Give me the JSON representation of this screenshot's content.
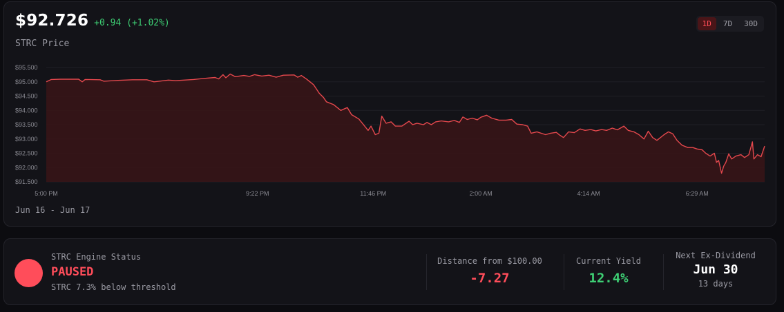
{
  "header": {
    "price": "$92.726",
    "change": "+0.94 (+1.02%)",
    "symbol_label": "STRC Price"
  },
  "timeframes": [
    {
      "label": "1D",
      "active": true
    },
    {
      "label": "7D",
      "active": false
    },
    {
      "label": "30D",
      "active": false
    }
  ],
  "date_range": "Jun 16 - Jun 17",
  "colors": {
    "line": "#e5484d",
    "fill": "#3a1518",
    "positive": "#3ecf74",
    "negative": "#ff4d5a"
  },
  "chart_data": {
    "type": "area",
    "y_ticks": [
      "$95.500",
      "$95.000",
      "$94.500",
      "$94.000",
      "$93.500",
      "$93.000",
      "$92.500",
      "$92.000",
      "$91.500"
    ],
    "ylim": [
      91.5,
      95.5
    ],
    "x_ticks": [
      "5:00 PM",
      "9:22 PM",
      "11:46 PM",
      "2:00 AM",
      "4:14 AM",
      "6:29 AM"
    ],
    "xlim": [
      0,
      100
    ],
    "x_tick_positions": [
      0,
      29.4,
      45.5,
      60.5,
      75.5,
      90.6
    ],
    "grid": true,
    "points": [
      [
        0,
        95.0
      ],
      [
        0.7,
        95.08
      ],
      [
        2,
        95.09
      ],
      [
        4.5,
        95.09
      ],
      [
        5,
        95.0
      ],
      [
        5.4,
        95.08
      ],
      [
        7.5,
        95.07
      ],
      [
        8,
        95.02
      ],
      [
        10,
        95.05
      ],
      [
        12,
        95.07
      ],
      [
        14,
        95.07
      ],
      [
        15,
        95.0
      ],
      [
        17,
        95.06
      ],
      [
        18,
        95.04
      ],
      [
        20.5,
        95.08
      ],
      [
        22,
        95.12
      ],
      [
        23.5,
        95.15
      ],
      [
        24,
        95.1
      ],
      [
        24.6,
        95.25
      ],
      [
        25,
        95.14
      ],
      [
        25.6,
        95.27
      ],
      [
        26.3,
        95.18
      ],
      [
        27.5,
        95.22
      ],
      [
        28.3,
        95.19
      ],
      [
        29,
        95.25
      ],
      [
        30,
        95.2
      ],
      [
        31,
        95.23
      ],
      [
        32,
        95.16
      ],
      [
        33,
        95.23
      ],
      [
        34.5,
        95.24
      ],
      [
        35,
        95.16
      ],
      [
        35.5,
        95.22
      ],
      [
        36.2,
        95.1
      ],
      [
        37.2,
        94.9
      ],
      [
        38,
        94.6
      ],
      [
        38.6,
        94.45
      ],
      [
        39,
        94.3
      ],
      [
        40,
        94.2
      ],
      [
        41,
        94.0
      ],
      [
        41.9,
        94.1
      ],
      [
        42.5,
        93.85
      ],
      [
        43.5,
        93.7
      ],
      [
        44,
        93.55
      ],
      [
        44.8,
        93.3
      ],
      [
        45.2,
        93.45
      ],
      [
        45.8,
        93.15
      ],
      [
        46.3,
        93.2
      ],
      [
        46.7,
        93.8
      ],
      [
        47.3,
        93.55
      ],
      [
        48,
        93.6
      ],
      [
        48.6,
        93.45
      ],
      [
        49.5,
        93.45
      ],
      [
        50.5,
        93.62
      ],
      [
        51,
        93.5
      ],
      [
        51.6,
        93.55
      ],
      [
        52.5,
        93.5
      ],
      [
        53,
        93.58
      ],
      [
        53.6,
        93.5
      ],
      [
        54.2,
        93.6
      ],
      [
        55,
        93.63
      ],
      [
        56,
        93.6
      ],
      [
        56.8,
        93.65
      ],
      [
        57.5,
        93.58
      ],
      [
        58,
        93.77
      ],
      [
        58.6,
        93.68
      ],
      [
        59.3,
        93.73
      ],
      [
        60,
        93.67
      ],
      [
        60.5,
        93.76
      ],
      [
        61.3,
        93.83
      ],
      [
        62,
        93.73
      ],
      [
        63,
        93.66
      ],
      [
        64,
        93.66
      ],
      [
        64.8,
        93.68
      ],
      [
        65.5,
        93.52
      ],
      [
        66.3,
        93.5
      ],
      [
        67,
        93.45
      ],
      [
        67.5,
        93.2
      ],
      [
        68.3,
        93.25
      ],
      [
        69.5,
        93.15
      ],
      [
        70.2,
        93.2
      ],
      [
        71,
        93.23
      ],
      [
        71.5,
        93.13
      ],
      [
        72,
        93.05
      ],
      [
        72.7,
        93.25
      ],
      [
        73.5,
        93.22
      ],
      [
        74.3,
        93.35
      ],
      [
        75,
        93.3
      ],
      [
        75.8,
        93.33
      ],
      [
        76.5,
        93.28
      ],
      [
        77.3,
        93.33
      ],
      [
        78,
        93.3
      ],
      [
        78.8,
        93.38
      ],
      [
        79.5,
        93.32
      ],
      [
        80.4,
        93.45
      ],
      [
        81,
        93.3
      ],
      [
        81.8,
        93.25
      ],
      [
        82.5,
        93.15
      ],
      [
        83.2,
        93.0
      ],
      [
        83.8,
        93.27
      ],
      [
        84.4,
        93.05
      ],
      [
        85,
        92.95
      ],
      [
        86,
        93.15
      ],
      [
        86.6,
        93.25
      ],
      [
        87.2,
        93.18
      ],
      [
        87.8,
        92.95
      ],
      [
        88.5,
        92.78
      ],
      [
        89.3,
        92.7
      ],
      [
        90,
        92.7
      ],
      [
        90.6,
        92.65
      ],
      [
        91.3,
        92.62
      ],
      [
        91.8,
        92.5
      ],
      [
        92.4,
        92.4
      ],
      [
        93,
        92.5
      ],
      [
        93.3,
        92.18
      ],
      [
        93.6,
        92.25
      ],
      [
        94,
        91.8
      ],
      [
        94.3,
        92.05
      ],
      [
        94.6,
        92.18
      ],
      [
        95,
        92.48
      ],
      [
        95.4,
        92.3
      ],
      [
        96,
        92.4
      ],
      [
        96.7,
        92.45
      ],
      [
        97.2,
        92.35
      ],
      [
        97.8,
        92.45
      ],
      [
        98.3,
        92.9
      ],
      [
        98.5,
        92.3
      ],
      [
        99,
        92.45
      ],
      [
        99.5,
        92.38
      ],
      [
        100,
        92.75
      ]
    ]
  },
  "status": {
    "engine_label": "STRC Engine Status",
    "engine_state": "PAUSED",
    "engine_sub": "STRC 7.3% below threshold",
    "distance_label": "Distance from $100.00",
    "distance_value": "-7.27",
    "yield_label": "Current Yield",
    "yield_value": "12.4%",
    "exdiv_label": "Next Ex-Dividend",
    "exdiv_value": "Jun 30",
    "exdiv_sub": "13 days"
  }
}
